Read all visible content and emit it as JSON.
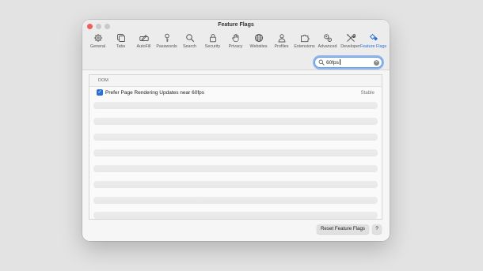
{
  "window": {
    "title": "Feature Flags"
  },
  "toolbar": {
    "items": [
      {
        "label": "General",
        "icon": "gear-icon"
      },
      {
        "label": "Tabs",
        "icon": "tabs-icon"
      },
      {
        "label": "AutoFill",
        "icon": "autofill-icon"
      },
      {
        "label": "Passwords",
        "icon": "key-icon"
      },
      {
        "label": "Search",
        "icon": "magnifier-icon"
      },
      {
        "label": "Security",
        "icon": "lock-icon"
      },
      {
        "label": "Privacy",
        "icon": "hand-icon"
      },
      {
        "label": "Websites",
        "icon": "globe-icon"
      },
      {
        "label": "Profiles",
        "icon": "person-icon"
      },
      {
        "label": "Extensions",
        "icon": "puzzle-icon"
      },
      {
        "label": "Advanced",
        "icon": "gears-icon"
      },
      {
        "label": "Developer",
        "icon": "wrench-screwdriver-icon"
      },
      {
        "label": "Feature Flags",
        "icon": "flags-icon"
      }
    ],
    "active": "Feature Flags",
    "accent": "#2a6fd6"
  },
  "search": {
    "value": "60fps"
  },
  "section": {
    "label": "DOM"
  },
  "flag": {
    "name": "Prefer Page Rendering Updates near 60fps",
    "status": "Stable",
    "checked": true
  },
  "footer": {
    "reset_label": "Reset Feature Flags",
    "help_label": "?"
  }
}
